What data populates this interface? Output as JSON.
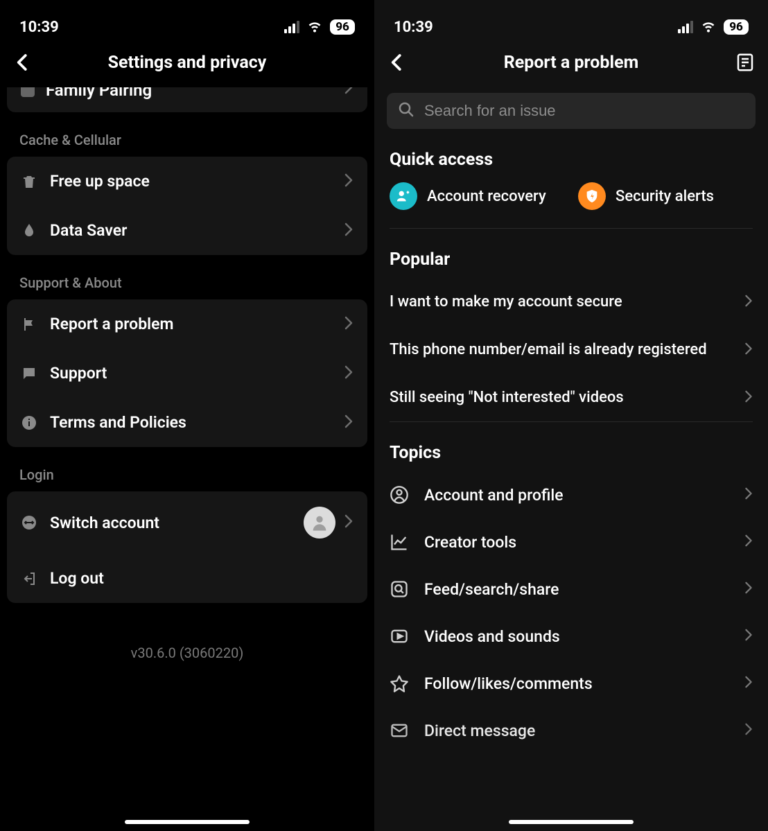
{
  "status": {
    "time": "10:39",
    "battery": "96"
  },
  "left": {
    "title": "Settings and privacy",
    "partial_row": "Family Pairing",
    "sections": {
      "cache": {
        "title": "Cache & Cellular",
        "items": [
          {
            "label": "Free up space"
          },
          {
            "label": "Data Saver"
          }
        ]
      },
      "support": {
        "title": "Support & About",
        "items": [
          {
            "label": "Report a problem"
          },
          {
            "label": "Support"
          },
          {
            "label": "Terms and Policies"
          }
        ]
      },
      "login": {
        "title": "Login",
        "items": [
          {
            "label": "Switch account"
          },
          {
            "label": "Log out"
          }
        ]
      }
    },
    "version": "v30.6.0 (3060220)"
  },
  "right": {
    "title": "Report a problem",
    "search_placeholder": "Search for an issue",
    "quick_title": "Quick access",
    "quick": [
      {
        "label": "Account recovery"
      },
      {
        "label": "Security alerts"
      }
    ],
    "popular_title": "Popular",
    "popular": [
      {
        "label": "I want to make my account secure"
      },
      {
        "label": "This phone number/email is already registered"
      },
      {
        "label": "Still seeing \"Not interested\" videos"
      }
    ],
    "topics_title": "Topics",
    "topics": [
      {
        "label": "Account and profile"
      },
      {
        "label": "Creator tools"
      },
      {
        "label": "Feed/search/share"
      },
      {
        "label": "Videos and sounds"
      },
      {
        "label": "Follow/likes/comments"
      },
      {
        "label": "Direct message"
      }
    ]
  }
}
